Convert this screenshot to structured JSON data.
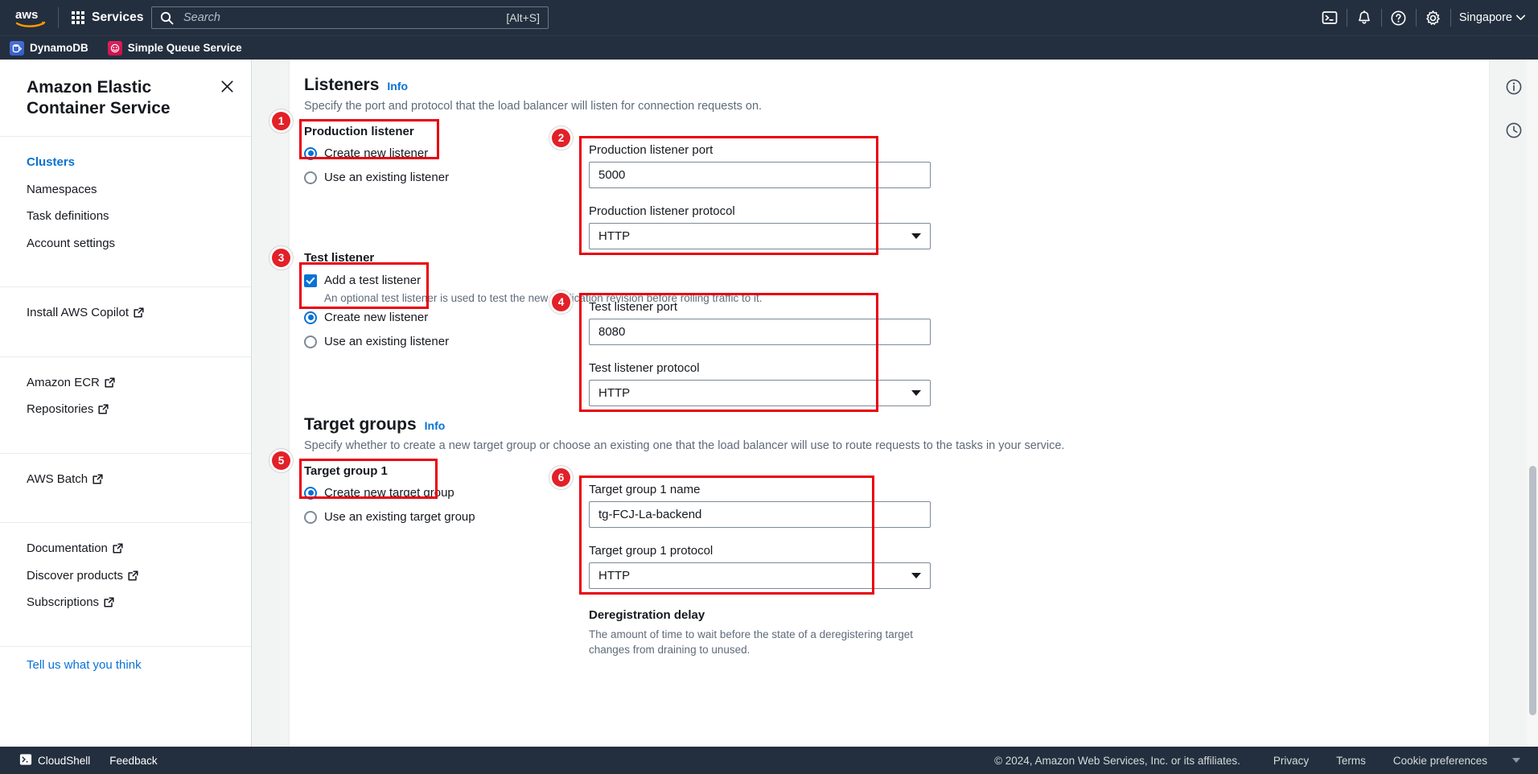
{
  "topnav": {
    "logo_alt": "aws",
    "services_label": "Services",
    "search_placeholder": "Search",
    "search_value": "",
    "search_shortcut": "[Alt+S]",
    "icons": [
      "cloudshell-icon",
      "bell-icon",
      "help-icon",
      "settings-icon"
    ],
    "region_label": "Singapore"
  },
  "favbar": {
    "items": [
      {
        "label": "DynamoDB",
        "icon": "dynamodb-icon"
      },
      {
        "label": "Simple Queue Service",
        "icon": "sqs-icon"
      }
    ]
  },
  "sidebar": {
    "title": "Amazon Elastic Container Service",
    "close_icon": "close-icon",
    "groups": [
      {
        "items": [
          {
            "label": "Clusters",
            "active": true,
            "external": false
          },
          {
            "label": "Namespaces",
            "active": false,
            "external": false
          },
          {
            "label": "Task definitions",
            "active": false,
            "external": false
          },
          {
            "label": "Account settings",
            "active": false,
            "external": false
          }
        ]
      },
      {
        "items": [
          {
            "label": "Install AWS Copilot",
            "active": false,
            "external": true
          }
        ]
      },
      {
        "items": [
          {
            "label": "Amazon ECR",
            "active": false,
            "external": true
          },
          {
            "label": "Repositories",
            "active": false,
            "external": true
          }
        ]
      },
      {
        "items": [
          {
            "label": "AWS Batch",
            "active": false,
            "external": true
          }
        ]
      },
      {
        "items": [
          {
            "label": "Documentation",
            "active": false,
            "external": true
          },
          {
            "label": "Discover products",
            "active": false,
            "external": true
          },
          {
            "label": "Subscriptions",
            "active": false,
            "external": true
          }
        ]
      }
    ],
    "feedback_link": "Tell us what you think"
  },
  "main": {
    "listeners": {
      "title": "Listeners",
      "info_label": "Info",
      "description": "Specify the port and protocol that the load balancer will listen for connection requests on.",
      "production": {
        "group_label": "Production listener",
        "option_create": "Create new listener",
        "option_existing": "Use an existing listener",
        "selected": "create",
        "port_label": "Production listener port",
        "port_value": "5000",
        "protocol_label": "Production listener protocol",
        "protocol_value": "HTTP"
      },
      "test": {
        "group_label": "Test listener",
        "checkbox_label": "Add a test listener",
        "checkbox_checked": true,
        "checkbox_hint": "An optional test listener is used to test the new application revision before rolling traffic to it.",
        "option_create": "Create new listener",
        "option_existing": "Use an existing listener",
        "selected": "create",
        "port_label": "Test listener port",
        "port_value": "8080",
        "protocol_label": "Test listener protocol",
        "protocol_value": "HTTP"
      }
    },
    "target_groups": {
      "title": "Target groups",
      "info_label": "Info",
      "description": "Specify whether to create a new target group or choose an existing one that the load balancer will use to route requests to the tasks in your service.",
      "group1": {
        "group_label": "Target group 1",
        "option_create": "Create new target group",
        "option_existing": "Use an existing target group",
        "selected": "create",
        "name_label": "Target group 1 name",
        "name_value": "tg-FCJ-La-backend",
        "protocol_label": "Target group 1 protocol",
        "protocol_value": "HTTP"
      },
      "deregistration": {
        "label": "Deregistration delay",
        "description": "The amount of time to wait before the state of a deregistering target changes from draining to unused."
      }
    },
    "annotations": [
      {
        "number": "1"
      },
      {
        "number": "2"
      },
      {
        "number": "3"
      },
      {
        "number": "4"
      },
      {
        "number": "5"
      },
      {
        "number": "6"
      }
    ]
  },
  "right_rail": {
    "icons": [
      "info-circle-icon",
      "history-clock-icon"
    ]
  },
  "footer": {
    "cloudshell_label": "CloudShell",
    "feedback_label": "Feedback",
    "copyright": "© 2024, Amazon Web Services, Inc. or its affiliates.",
    "links": [
      "Privacy",
      "Terms",
      "Cookie preferences"
    ]
  },
  "colors": {
    "nav_bg": "#232f3e",
    "accent_blue": "#0972d3",
    "annotation_red": "#e8000d",
    "badge_red": "#e22028",
    "text": "#16191f",
    "muted": "#5f6b7a"
  }
}
